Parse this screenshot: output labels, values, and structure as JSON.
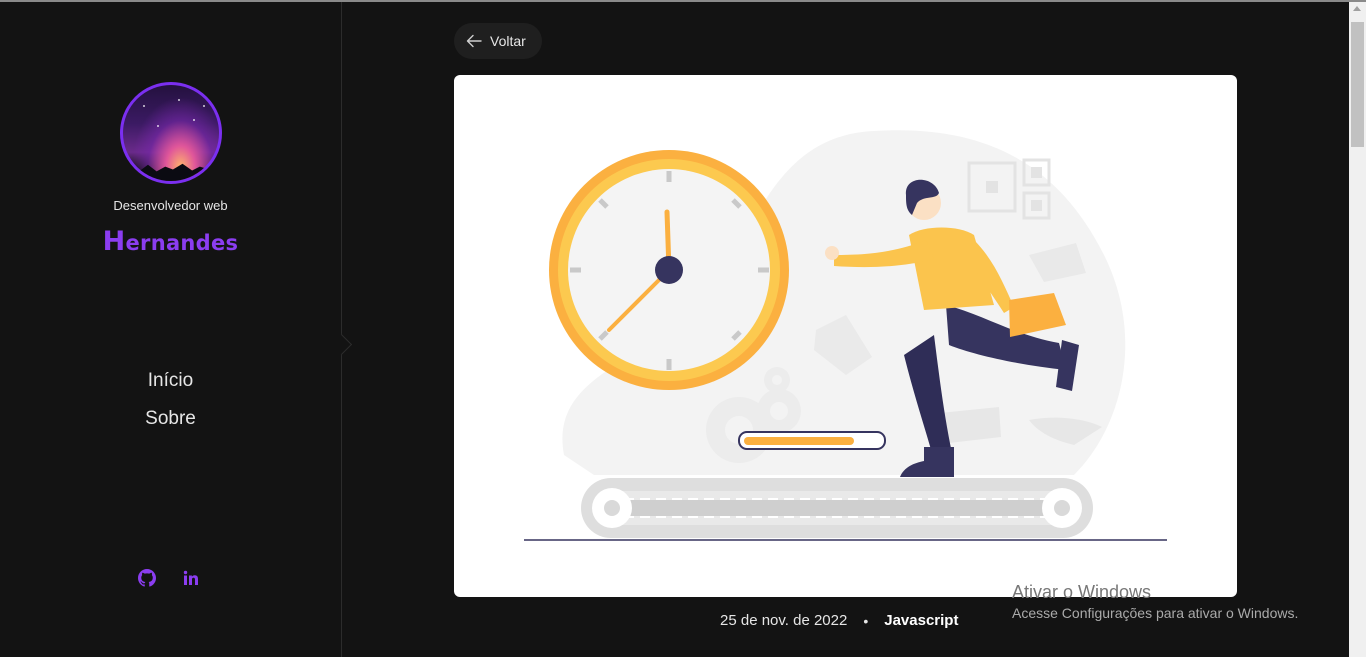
{
  "sidebar": {
    "subtitle": "Desenvolvedor web",
    "logo_first": "H",
    "logo_rest": "ernandes",
    "nav": [
      {
        "label": "Início"
      },
      {
        "label": "Sobre"
      }
    ],
    "social": [
      {
        "icon": "github-icon"
      },
      {
        "icon": "linkedin-icon"
      }
    ]
  },
  "main": {
    "back_label": "Voltar",
    "date": "25 de nov. de 2022",
    "separator": "•",
    "tag": "Javascript"
  },
  "watermark": {
    "title": "Ativar o Windows",
    "subtitle": "Acesse Configurações para ativar o Windows."
  },
  "colors": {
    "accent": "#8b3df0",
    "background": "#131313",
    "clock": "#fbb040",
    "figure_shirt": "#fbc44d",
    "figure_pants": "#36345f"
  }
}
